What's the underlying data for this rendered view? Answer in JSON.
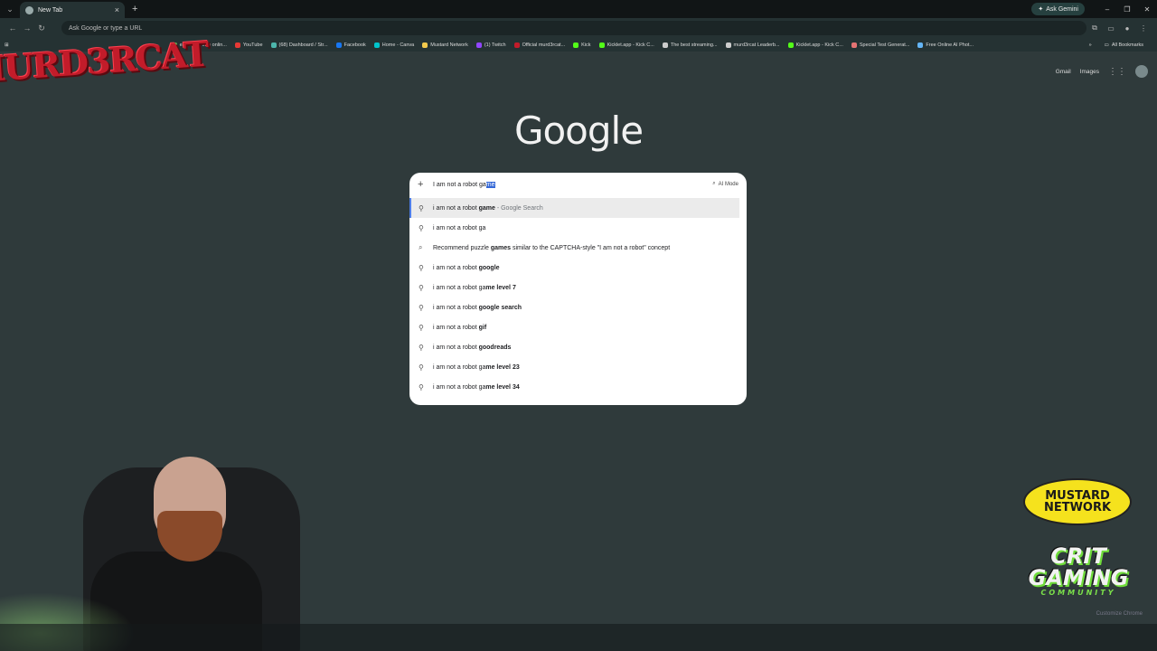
{
  "browser": {
    "tab_title": "New Tab",
    "new_tab_symbol": "+",
    "ask_gemini": "Ask Gemini",
    "omnibox_placeholder": "Ask Google or type a URL"
  },
  "bookmarks": [
    {
      "label": "ezgif.com free onlin...",
      "color": "#6aa84f"
    },
    {
      "label": "YouTube",
      "color": "#e53935"
    },
    {
      "label": "(68) Dashboard / Str...",
      "color": "#4db6ac"
    },
    {
      "label": "Facebook",
      "color": "#1877f2"
    },
    {
      "label": "Home - Canva",
      "color": "#00c4cc"
    },
    {
      "label": "Mustard Network",
      "color": "#f2c94c"
    },
    {
      "label": "(1) Twitch",
      "color": "#9146ff"
    },
    {
      "label": "Official murd3rcat...",
      "color": "#c21c2a"
    },
    {
      "label": "Kick",
      "color": "#53fc18"
    },
    {
      "label": "Kicklet.app - Kick C...",
      "color": "#53fc18"
    },
    {
      "label": "The best streaming...",
      "color": "#cccccc"
    },
    {
      "label": "murd3rcat Leaderb...",
      "color": "#cccccc"
    },
    {
      "label": "Kicklet.app - Kick C...",
      "color": "#53fc18"
    },
    {
      "label": "Special Test Generat...",
      "color": "#e57373"
    },
    {
      "label": "Free Online AI Phot...",
      "color": "#64b5f6"
    }
  ],
  "bookmarks_more": "»",
  "all_bookmarks": "All Bookmarks",
  "google": {
    "gmail": "Gmail",
    "images": "Images",
    "logo": "Google"
  },
  "search": {
    "query_typed": "I am not a robot ga",
    "query_autocomplete": "me",
    "ai_mode": "AI Mode"
  },
  "suggestions": [
    {
      "prefix": "i am not a robot ",
      "bold": "game",
      "suffix": " - Google Search",
      "icon": "search-icon"
    },
    {
      "prefix": "i am not a robot ga",
      "bold": "",
      "suffix": "",
      "icon": "search-icon"
    },
    {
      "prefix": "Recommend puzzle ",
      "bold": "games",
      "suffix": " similar to the CAPTCHA-style \"I am not a robot\" concept",
      "icon": "ai-search-icon"
    },
    {
      "prefix": "i am not a robot ",
      "bold": "google",
      "suffix": "",
      "icon": "search-icon"
    },
    {
      "prefix": "i am not a robot ga",
      "bold": "me level 7",
      "suffix": "",
      "icon": "search-icon"
    },
    {
      "prefix": "i am not a robot ",
      "bold": "google search",
      "suffix": "",
      "icon": "search-icon"
    },
    {
      "prefix": "i am not a robot ",
      "bold": "gif",
      "suffix": "",
      "icon": "search-icon"
    },
    {
      "prefix": "i am not a robot ",
      "bold": "goodreads",
      "suffix": "",
      "icon": "search-icon"
    },
    {
      "prefix": "i am not a robot ga",
      "bold": "me level 23",
      "suffix": "",
      "icon": "search-icon"
    },
    {
      "prefix": "i am not a robot ga",
      "bold": "me level 34",
      "suffix": "",
      "icon": "search-icon"
    }
  ],
  "overlays": {
    "channel_logo": "MURD3RCAT",
    "mustard_line1": "MUSTARD",
    "mustard_line2": "NETWORK",
    "crit_line1": "CRIT",
    "crit_line2": "GAMING",
    "crit_line3": "COMMUNITY"
  },
  "customize_chrome": "Customize Chrome"
}
